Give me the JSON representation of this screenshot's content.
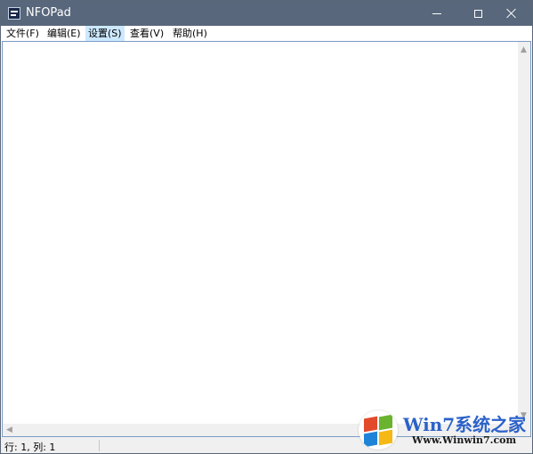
{
  "window": {
    "title": "NFOPad",
    "icon": "nfo-app-icon",
    "controls": [
      "minimize-icon",
      "maximize-icon",
      "close-icon"
    ]
  },
  "menu": {
    "items": [
      {
        "label": "文件(F)"
      },
      {
        "label": "编辑(E)"
      },
      {
        "label": "设置(S)",
        "state": "hovered"
      },
      {
        "label": "查看(V)"
      },
      {
        "label": "帮助(H)"
      }
    ]
  },
  "editor": {
    "content": "",
    "scrollbars": [
      "vertical",
      "horizontal"
    ]
  },
  "status": {
    "position": "行: 1, 列: 1"
  },
  "watermark": {
    "title": "Win7系统之家",
    "url": "Www.Winwin7.com"
  },
  "colors": {
    "titlebar": "#58677b",
    "menu_hover": "#cce8ff",
    "editor_border": "#7a9bc4",
    "watermark_title": "#2c62c9"
  }
}
